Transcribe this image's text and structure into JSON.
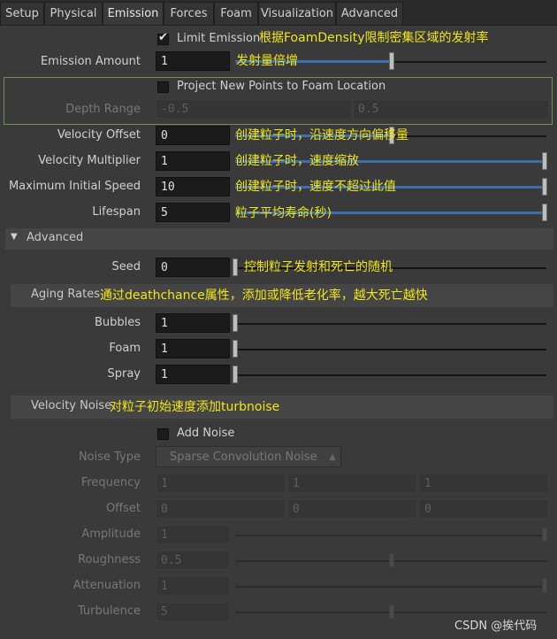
{
  "tabs": [
    "Setup",
    "Physical",
    "Emission",
    "Forces",
    "Foam",
    "Visualization",
    "Advanced"
  ],
  "active_tab": "Emission",
  "limit_emission": {
    "label": "Limit Emission",
    "checked": true,
    "note": "根据FoamDensity限制密集区域的发射率"
  },
  "emission_amount": {
    "label": "Emission Amount",
    "value": "1",
    "note": "发射量倍增"
  },
  "project_points": {
    "label": "Project New Points to Foam Location",
    "checked": false
  },
  "depth_range": {
    "label": "Depth Range",
    "min": "-0.5",
    "max": "0.5"
  },
  "velocity_offset": {
    "label": "Velocity Offset",
    "value": "0",
    "note": "创建粒子时，沿速度方向偏移量"
  },
  "velocity_multiplier": {
    "label": "Velocity Multiplier",
    "value": "1",
    "note": "创建粒子时，速度缩放"
  },
  "max_initial_speed": {
    "label": "Maximum Initial Speed",
    "value": "10",
    "note": "创建粒子时，速度不超过此值"
  },
  "lifespan": {
    "label": "Lifespan",
    "value": "5",
    "note": "粒子平均寿命(秒)"
  },
  "advanced_section": {
    "label": "Advanced"
  },
  "seed": {
    "label": "Seed",
    "value": "0",
    "note": "控制粒子发射和死亡的随机"
  },
  "aging_rates": {
    "label": "Aging Rates",
    "note": "通过deathchance属性，添加或降低老化率，越大死亡越快"
  },
  "bubbles": {
    "label": "Bubbles",
    "value": "1"
  },
  "foam": {
    "label": "Foam",
    "value": "1"
  },
  "spray": {
    "label": "Spray",
    "value": "1"
  },
  "velocity_noise": {
    "label": "Velocity Noise",
    "note": "对粒子初始速度添加turbnoise"
  },
  "add_noise": {
    "label": "Add Noise",
    "checked": false
  },
  "noise_type": {
    "label": "Noise Type",
    "value": "Sparse Convolution Noise"
  },
  "frequency": {
    "label": "Frequency",
    "values": [
      "1",
      "1",
      "1"
    ]
  },
  "offset": {
    "label": "Offset",
    "values": [
      "0",
      "0",
      "0"
    ]
  },
  "amplitude": {
    "label": "Amplitude",
    "value": "1"
  },
  "roughness": {
    "label": "Roughness",
    "value": "0.5"
  },
  "attenuation": {
    "label": "Attenuation",
    "value": "1"
  },
  "turbulence": {
    "label": "Turbulence",
    "value": "5"
  },
  "watermark": "CSDN @挨代码",
  "colors": {
    "note": "#f2e61a",
    "slider_fill": "#3b6fb0",
    "group_border": "#6b8f55"
  }
}
